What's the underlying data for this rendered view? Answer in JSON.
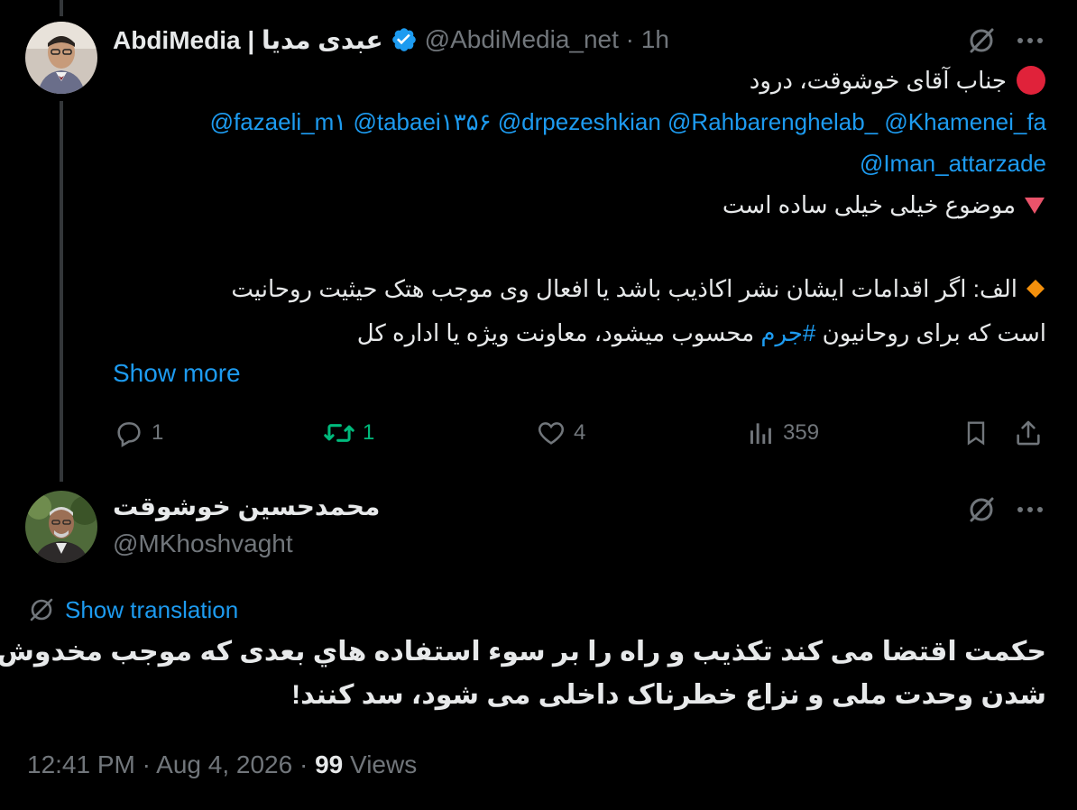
{
  "tweet1": {
    "display_name": "AbdiMedia | عبدی مدیا",
    "handle_time": "@AbdiMedia_net · 1h",
    "line1": "جناب آقای خوشوقت، درود",
    "mentions_line1": "@fazaeli_m۱ @tabaei۱۳۵۶ @drpezeshkian @Rahbarenghelab_ @Khamenei_fa",
    "mentions_line2": "@Iman_attarzade",
    "line_topic": "موضوع خیلی خیلی ساده است",
    "para_line1": "الف: اگر اقدامات ایشان نشر اکاذیب باشد یا افعال وی موجب هتک حیثیت روحانیت",
    "para_line2_pre": "است که برای روحانیون",
    "para_line2_hashtag": "#جرم",
    "para_line2_post": "محسوب میشود، معاونت ویژه یا اداره کل",
    "show_more": "Show more",
    "stats": {
      "replies": "1",
      "retweets": "1",
      "likes": "4",
      "views": "359"
    }
  },
  "tweet2": {
    "display_name": "محمدحسین خوشوقت",
    "handle": "@MKhoshvaght",
    "show_translation": "Show translation",
    "text_line1": "حکمت اقتضا می کند تکذیب  و راه را بر سوء استفاده هاي بعدی که موجب مخدوش",
    "text_line2": "شدن وحدت ملی و نزاع خطرناک داخلی می شود، سد کنند!",
    "time": "12:41 PM · Aug 4, 2026 ·",
    "views_count": "99",
    "views_label": "Views"
  },
  "colors": {
    "accent": "#1d9bf0",
    "retweet": "#00ba7c",
    "muted": "#71767b"
  },
  "icons": [
    "verified-badge-icon",
    "grok-icon",
    "more-icon",
    "reply-icon",
    "retweet-icon",
    "like-icon",
    "views-icon",
    "bookmark-icon",
    "share-icon",
    "red-circle-emoji",
    "red-triangle-emoji",
    "orange-diamond-emoji",
    "translate-icon"
  ]
}
